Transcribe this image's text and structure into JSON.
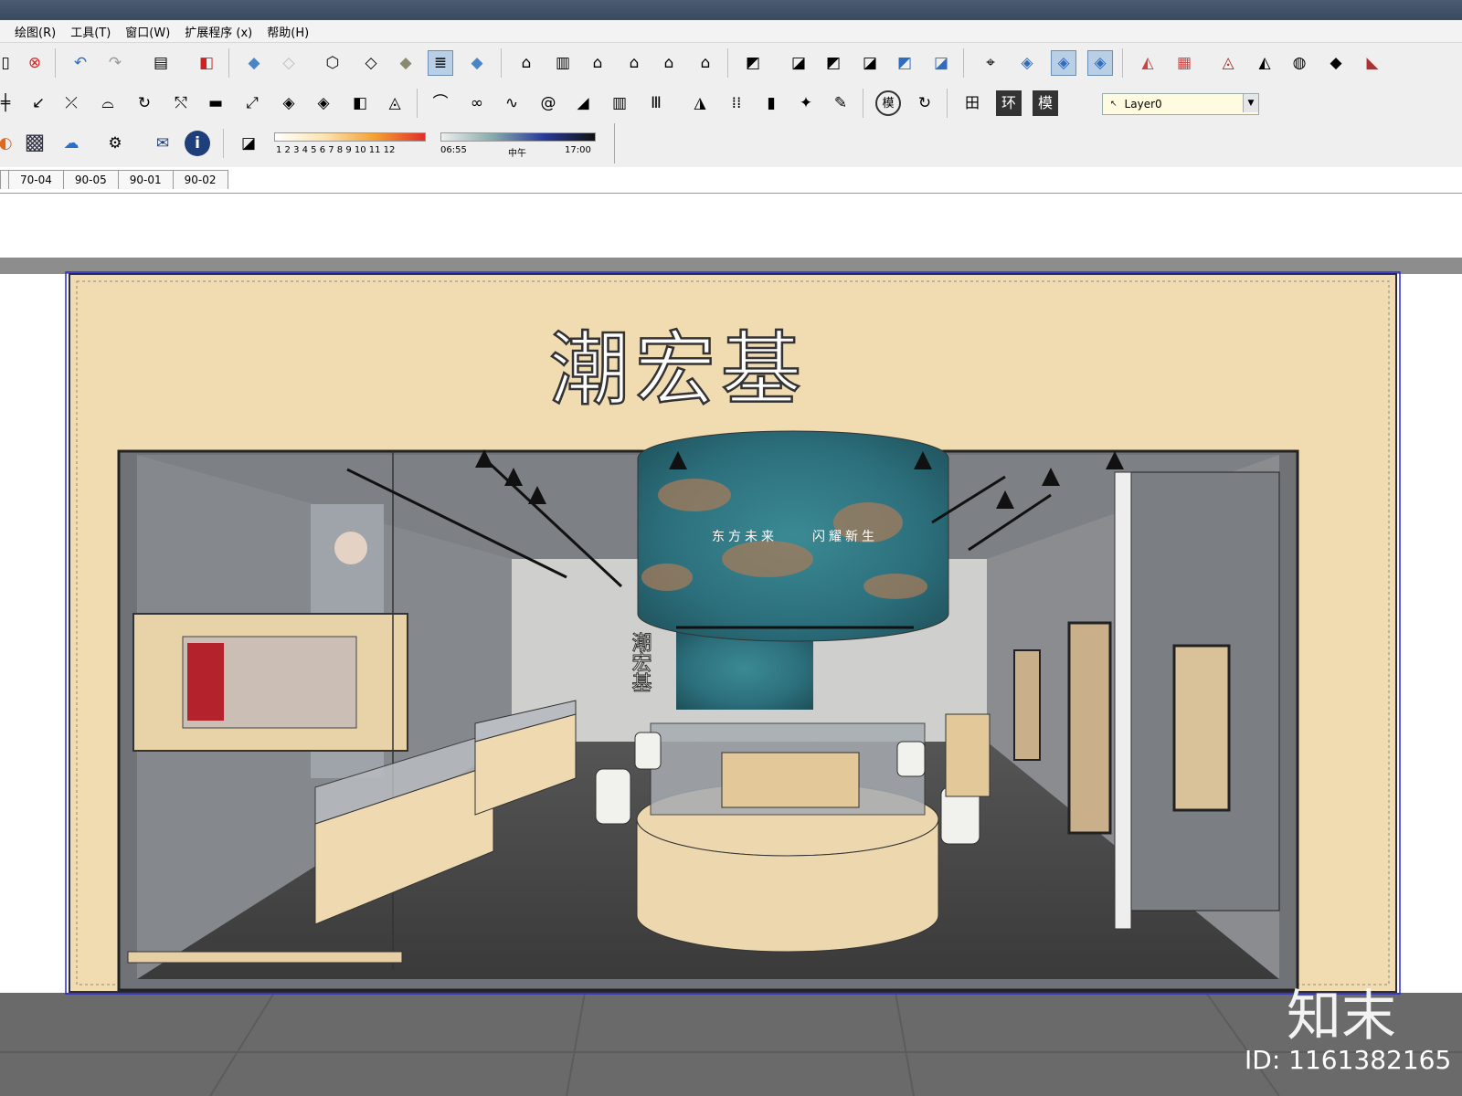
{
  "menu": [
    "绘图(R)",
    "工具(T)",
    "窗口(W)",
    "扩展程序 (x)",
    "帮助(H)"
  ],
  "layer": {
    "value": "Layer0"
  },
  "shadow_slider": {
    "months": "1 2 3 4 5 6 7 8 9 10 11 12",
    "start_time": "06:55",
    "mid_label": "中午",
    "end_time": "17:00"
  },
  "scene_tabs": [
    "70-04",
    "90-05",
    "90-01",
    "90-02"
  ],
  "toolbar_buttons": {
    "label_mo": "模",
    "label_grid": "田",
    "label_huan": "环",
    "label_mo2": "模"
  },
  "store": {
    "brand_sign": "潮宏基",
    "drum_text_left": "东方未来",
    "drum_text_right": "闪耀新生",
    "vertical_sign": "潮宏基"
  },
  "watermark": {
    "logo": "知末",
    "id": "ID: 1161382165"
  },
  "colors": {
    "facade": "#f1dcb2",
    "floor_dark": "#3b3b3d",
    "wall_grey": "#7b7e82",
    "sky_blue": "#2c7a8a"
  }
}
